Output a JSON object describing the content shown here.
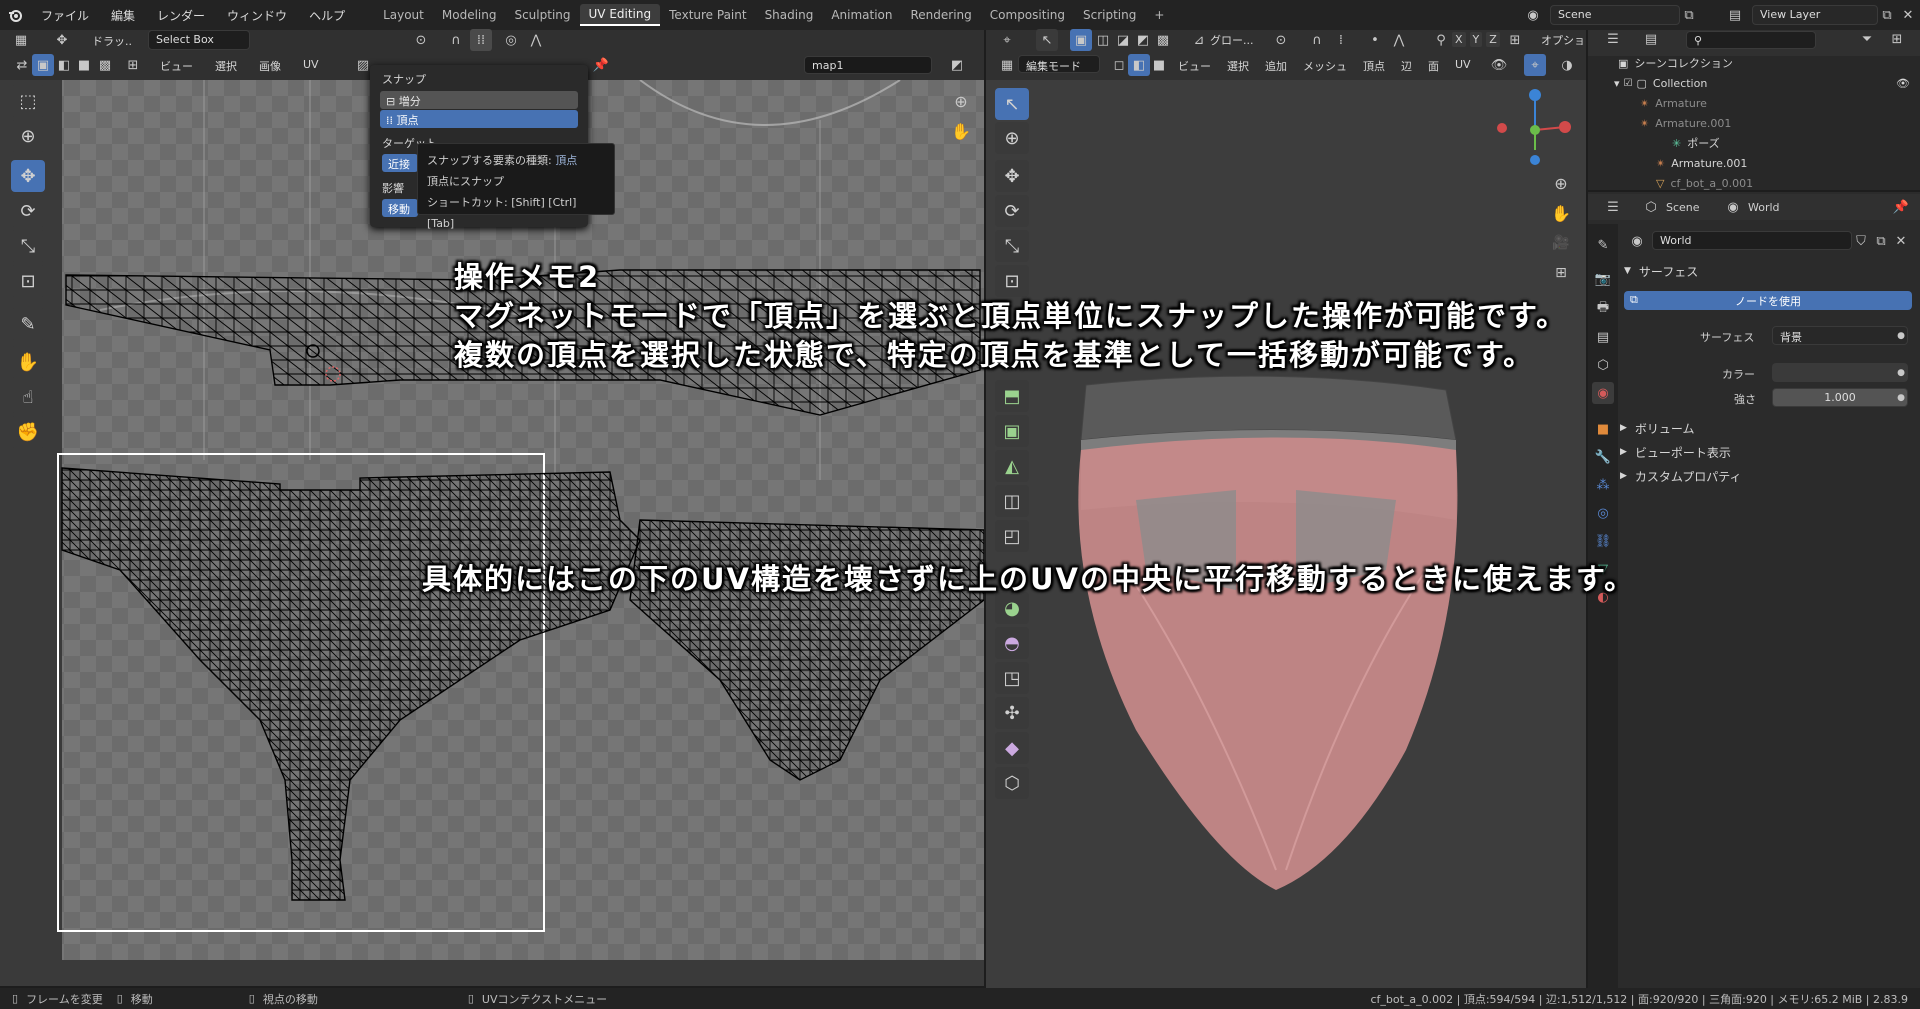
{
  "topbar": {
    "menus": [
      "ファイル",
      "編集",
      "レンダー",
      "ウィンドウ",
      "ヘルプ"
    ],
    "workspace_tabs": [
      "Layout",
      "Modeling",
      "Sculpting",
      "UV Editing",
      "Texture Paint",
      "Shading",
      "Animation",
      "Rendering",
      "Compositing",
      "Scripting"
    ],
    "active_tab": "UV Editing",
    "add_tab": "+",
    "scene": "Scene",
    "view_layer": "View Layer"
  },
  "uv_editor": {
    "drag_label": "ドラッ..",
    "select_mode": "Select Box",
    "menus": [
      "ビュー",
      "選択",
      "画像",
      "UV"
    ],
    "image_name": "map1"
  },
  "snap_popup": {
    "title": "スナップ",
    "options": [
      "増分",
      "頂点"
    ],
    "selected": "頂点",
    "target_label": "ターゲット",
    "target_value": "近接",
    "affect_label": "影響",
    "affect_value": "移動"
  },
  "tooltip": {
    "line1_prefix": "スナップする要素の種類:",
    "line1_value": "頂点",
    "line2": "頂点にスナップ",
    "line3": "ショートカット: [Shift] [Ctrl] [Tab]"
  },
  "viewport3d": {
    "mode": "編集モード",
    "menus": [
      "ビュー",
      "選択",
      "追加",
      "メッシュ",
      "頂点",
      "辺",
      "面",
      "UV"
    ],
    "transform_orientation": "グロー...",
    "axes": [
      "X",
      "Y",
      "Z"
    ],
    "options": "オプショ"
  },
  "overlay": {
    "title": "操作メモ2",
    "line1": "マグネットモードで「頂点」を選ぶと頂点単位にスナップした操作が可能です。",
    "line2": "複数の頂点を選択した状態で、特定の頂点を基準として一括移動が可能です。",
    "line3": "具体的にはこの下のUV構造を壊さずに上のUVの中央に平行移動するときに使えます。"
  },
  "outliner": {
    "root": "シーンコレクション",
    "items": [
      {
        "label": "Collection",
        "indent": 0
      },
      {
        "label": "Armature",
        "indent": 1
      },
      {
        "label": "Armature.001",
        "indent": 1
      },
      {
        "label": "ポーズ",
        "indent": 2
      },
      {
        "label": "Armature.001",
        "indent": 2
      },
      {
        "label": "cf_bot_a_0.001",
        "indent": 2
      }
    ]
  },
  "properties": {
    "scene": "Scene",
    "world_tab": "World",
    "world_name": "World",
    "surface_section": "サーフェス",
    "use_nodes_button": "ノードを使用",
    "surface_label": "サーフェス",
    "surface_value": "背景",
    "color_label": "カラー",
    "strength_label": "強さ",
    "strength_value": "1.000",
    "sections": [
      "ボリューム",
      "ビューポート表示",
      "カスタムプロパティ"
    ]
  },
  "statusbar": {
    "items": [
      "フレームを変更",
      "移動",
      "視点の移動",
      "UVコンテクストメニュー"
    ],
    "stats": "cf_bot_a_0.002 | 頂点:594/594 | 辺:1,512/1,512 | 面:920/920 | 三角面:920 | メモリ:65.2 MiB | 2.83.9"
  },
  "colors": {
    "accent": "#4772b3",
    "header": "#303030",
    "viewport_bg": "#3d3d3d",
    "mesh_pink": "#c98a8a"
  }
}
